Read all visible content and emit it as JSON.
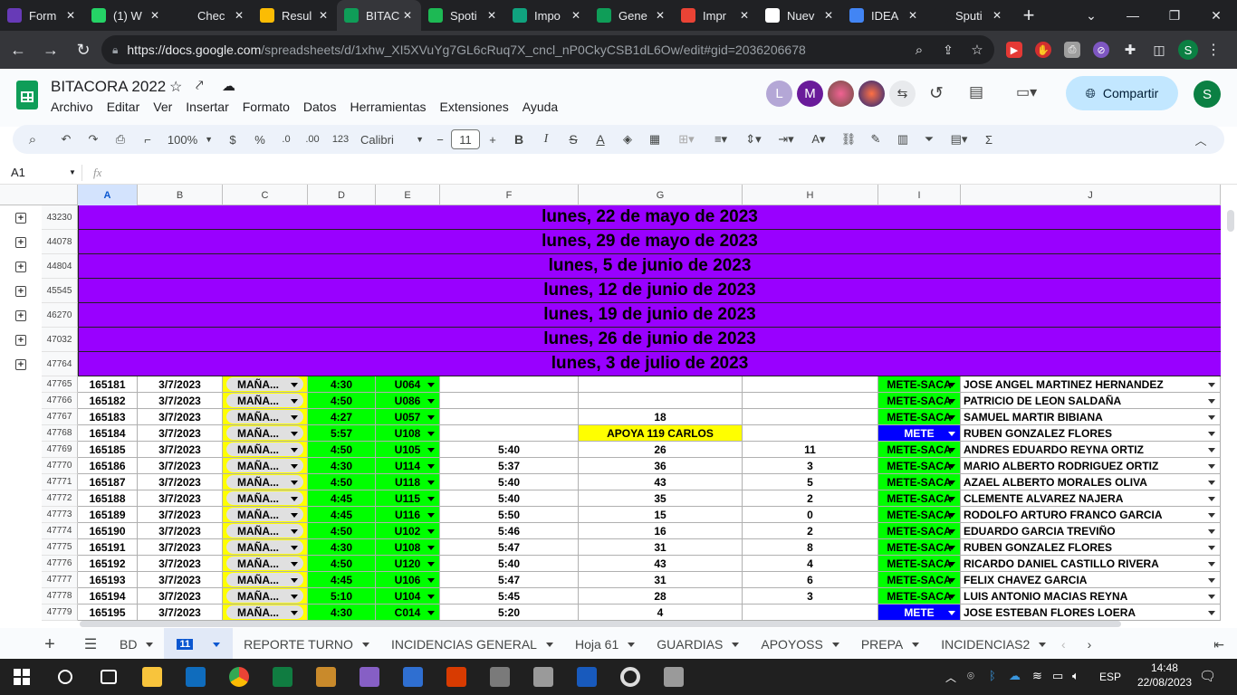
{
  "browser": {
    "tabs": [
      {
        "label": "Form",
        "icon": "forms-icon",
        "color": "#673ab7"
      },
      {
        "label": "(1) W",
        "icon": "whatsapp-icon",
        "color": "#25d366"
      },
      {
        "label": "Chec",
        "icon": "app-a-icon",
        "color": "#202124"
      },
      {
        "label": "Resul",
        "icon": "drive-icon",
        "color": "#fbbc04"
      },
      {
        "label": "BITAC",
        "icon": "sheets-icon",
        "color": "#0f9d58"
      },
      {
        "label": "Spoti",
        "icon": "spotify-icon",
        "color": "#1db954"
      },
      {
        "label": "Impo",
        "icon": "openai-icon",
        "color": "#10a37f"
      },
      {
        "label": "Gene",
        "icon": "calendar-icon",
        "color": "#0f9d58"
      },
      {
        "label": "Impr",
        "icon": "pdf-icon",
        "color": "#ea4335"
      },
      {
        "label": "Nuev",
        "icon": "github-icon",
        "color": "#ffffff"
      },
      {
        "label": "IDEA",
        "icon": "google-icon",
        "color": "#4285f4"
      },
      {
        "label": "Sputi",
        "icon": "app-a-icon",
        "color": "#202124"
      }
    ],
    "url_host": "https://docs.google.com",
    "url_path": "/spreadsheets/d/1xhw_XI5XVuYg7GL6cRuq7X_cncl_nP0CkyCSB1dL6Ow/edit#gid=2036206678",
    "profile_initial": "S"
  },
  "doc": {
    "title": "BITACORA 2022",
    "menu": [
      "Archivo",
      "Editar",
      "Ver",
      "Insertar",
      "Formato",
      "Datos",
      "Herramientas",
      "Extensiones",
      "Ayuda"
    ],
    "share_label": "Compartir",
    "user_initial": "S",
    "collaborators": [
      {
        "initial": "L",
        "color": "#b4a7d6"
      },
      {
        "initial": "M",
        "color": "#6a1b9a"
      }
    ]
  },
  "toolbar": {
    "zoom": "100%",
    "currency": "$",
    "percent": "%",
    "dec_less": ".0",
    "dec_more": ".00",
    "format_123": "123",
    "font": "Calibri",
    "font_size": "11",
    "bold": "B",
    "italic": "I",
    "strike": "S",
    "text_color": "A",
    "sigma": "Σ"
  },
  "formula_bar": {
    "cell": "A1",
    "fx": "fx"
  },
  "columns": [
    {
      "letter": "A",
      "selected": true
    },
    {
      "letter": "B"
    },
    {
      "letter": "C"
    },
    {
      "letter": "D"
    },
    {
      "letter": "E"
    },
    {
      "letter": "F"
    },
    {
      "letter": "G"
    },
    {
      "letter": "H"
    },
    {
      "letter": "I"
    },
    {
      "letter": "J"
    }
  ],
  "banners": [
    {
      "row": "43230",
      "text": "lunes, 22 de mayo de 2023"
    },
    {
      "row": "44078",
      "text": "lunes, 29 de mayo de 2023"
    },
    {
      "row": "44804",
      "text": "lunes, 5 de junio de 2023"
    },
    {
      "row": "45545",
      "text": "lunes, 12 de junio de 2023"
    },
    {
      "row": "46270",
      "text": "lunes, 19 de junio de 2023"
    },
    {
      "row": "47032",
      "text": "lunes, 26 de junio de 2023"
    },
    {
      "row": "47764",
      "text": "lunes, 3 de julio de 2023"
    }
  ],
  "rows": [
    {
      "row": "47765",
      "a": "165181",
      "b": "3/7/2023",
      "c": "MAÑA...",
      "d": "4:30",
      "e": "U064",
      "f": "",
      "g": "",
      "h": "",
      "i": "METE-SACA",
      "j": "JOSE ANGEL MARTINEZ HERNANDEZ"
    },
    {
      "row": "47766",
      "a": "165182",
      "b": "3/7/2023",
      "c": "MAÑA...",
      "d": "4:50",
      "e": "U086",
      "f": "",
      "g": "",
      "h": "",
      "i": "METE-SACA",
      "j": "PATRICIO DE LEON SALDAÑA"
    },
    {
      "row": "47767",
      "a": "165183",
      "b": "3/7/2023",
      "c": "MAÑA...",
      "d": "4:27",
      "e": "U057",
      "f": "",
      "g": "18",
      "h": "",
      "i": "METE-SACA",
      "j": "SAMUEL MARTIR BIBIANA"
    },
    {
      "row": "47768",
      "a": "165184",
      "b": "3/7/2023",
      "c": "MAÑA...",
      "d": "5:57",
      "e": "U108",
      "f": "",
      "g": "APOYA 119 CARLOS",
      "h": "",
      "i": "METE",
      "j": "RUBEN GONZALEZ FLORES"
    },
    {
      "row": "47769",
      "a": "165185",
      "b": "3/7/2023",
      "c": "MAÑA...",
      "d": "4:50",
      "e": "U105",
      "f": "5:40",
      "g": "26",
      "h": "11",
      "i": "METE-SACA",
      "j": "ANDRES EDUARDO REYNA ORTIZ"
    },
    {
      "row": "47770",
      "a": "165186",
      "b": "3/7/2023",
      "c": "MAÑA...",
      "d": "4:30",
      "e": "U114",
      "f": "5:37",
      "g": "36",
      "h": "3",
      "i": "METE-SACA",
      "j": "MARIO ALBERTO RODRIGUEZ ORTIZ"
    },
    {
      "row": "47771",
      "a": "165187",
      "b": "3/7/2023",
      "c": "MAÑA...",
      "d": "4:50",
      "e": "U118",
      "f": "5:40",
      "g": "43",
      "h": "5",
      "i": "METE-SACA",
      "j": "AZAEL ALBERTO MORALES OLIVA"
    },
    {
      "row": "47772",
      "a": "165188",
      "b": "3/7/2023",
      "c": "MAÑA...",
      "d": "4:45",
      "e": "U115",
      "f": "5:40",
      "g": "35",
      "h": "2",
      "i": "METE-SACA",
      "j": "CLEMENTE  ALVAREZ NAJERA"
    },
    {
      "row": "47773",
      "a": "165189",
      "b": "3/7/2023",
      "c": "MAÑA...",
      "d": "4:45",
      "e": "U116",
      "f": "5:50",
      "g": "15",
      "h": "0",
      "i": "METE-SACA",
      "j": "RODOLFO ARTURO FRANCO GARCIA"
    },
    {
      "row": "47774",
      "a": "165190",
      "b": "3/7/2023",
      "c": "MAÑA...",
      "d": "4:50",
      "e": "U102",
      "f": "5:46",
      "g": "16",
      "h": "2",
      "i": "METE-SACA",
      "j": "EDUARDO GARCIA TREVIÑO"
    },
    {
      "row": "47775",
      "a": "165191",
      "b": "3/7/2023",
      "c": "MAÑA...",
      "d": "4:30",
      "e": "U108",
      "f": "5:47",
      "g": "31",
      "h": "8",
      "i": "METE-SACA",
      "j": "RUBEN GONZALEZ FLORES"
    },
    {
      "row": "47776",
      "a": "165192",
      "b": "3/7/2023",
      "c": "MAÑA...",
      "d": "4:50",
      "e": "U120",
      "f": "5:40",
      "g": "43",
      "h": "4",
      "i": "METE-SACA",
      "j": "RICARDO DANIEL  CASTILLO  RIVERA"
    },
    {
      "row": "47777",
      "a": "165193",
      "b": "3/7/2023",
      "c": "MAÑA...",
      "d": "4:45",
      "e": "U106",
      "f": "5:47",
      "g": "31",
      "h": "6",
      "i": "METE-SACA",
      "j": "FELIX CHAVEZ GARCIA"
    },
    {
      "row": "47778",
      "a": "165194",
      "b": "3/7/2023",
      "c": "MAÑA...",
      "d": "5:10",
      "e": "U104",
      "f": "5:45",
      "g": "28",
      "h": "3",
      "i": "METE-SACA",
      "j": "LUIS ANTONIO MACIAS REYNA"
    },
    {
      "row": "47779",
      "a": "165195",
      "b": "3/7/2023",
      "c": "MAÑA...",
      "d": "4:30",
      "e": "C014",
      "f": "5:20",
      "g": "4",
      "h": "",
      "i": "METE",
      "j": "JOSE ESTEBAN FLORES LOERA"
    }
  ],
  "colors": {
    "banner": "#9900ff",
    "green": "#00ff00",
    "yellow": "#ffff00",
    "blue": "#0000ff",
    "chip_gray": "#e0e0e0"
  },
  "sheets": [
    {
      "label": "BD",
      "active": false
    },
    {
      "label": "11",
      "active": true
    },
    {
      "label": "REPORTE TURNO",
      "active": false
    },
    {
      "label": "INCIDENCIAS GENERAL",
      "active": false
    },
    {
      "label": "Hoja 61",
      "active": false
    },
    {
      "label": "GUARDIAS",
      "active": false
    },
    {
      "label": "APOYOSS",
      "active": false
    },
    {
      "label": "PREPA",
      "active": false
    },
    {
      "label": "INCIDENCIAS2",
      "active": false
    },
    {
      "label": "GUARDIA",
      "active": false
    }
  ],
  "taskbar": {
    "apps": [
      {
        "name": "search-icon",
        "color": "#ffffff"
      },
      {
        "name": "taskview-icon",
        "color": "#ffffff"
      },
      {
        "name": "file-explorer-icon",
        "color": "#f8c43c"
      },
      {
        "name": "outlook-icon",
        "color": "#0f6cbd"
      },
      {
        "name": "chrome-icon",
        "color": "#ea4335"
      },
      {
        "name": "excel-icon",
        "color": "#107c41"
      },
      {
        "name": "tools-icon",
        "color": "#c98a2b"
      },
      {
        "name": "visual-studio-icon",
        "color": "#865fc5"
      },
      {
        "name": "news-icon",
        "color": "#2f6fd1"
      },
      {
        "name": "office-icon",
        "color": "#d83b01"
      },
      {
        "name": "calculator-icon",
        "color": "#7a7a7a"
      },
      {
        "name": "printer-app-icon",
        "color": "#9a9a9a"
      },
      {
        "name": "word-icon",
        "color": "#185abd"
      },
      {
        "name": "settings-icon",
        "color": "#bbbbbb"
      },
      {
        "name": "printer-app-icon-2",
        "color": "#9a9a9a"
      }
    ],
    "lang": "ESP",
    "time": "14:48",
    "date": "22/08/2023"
  }
}
